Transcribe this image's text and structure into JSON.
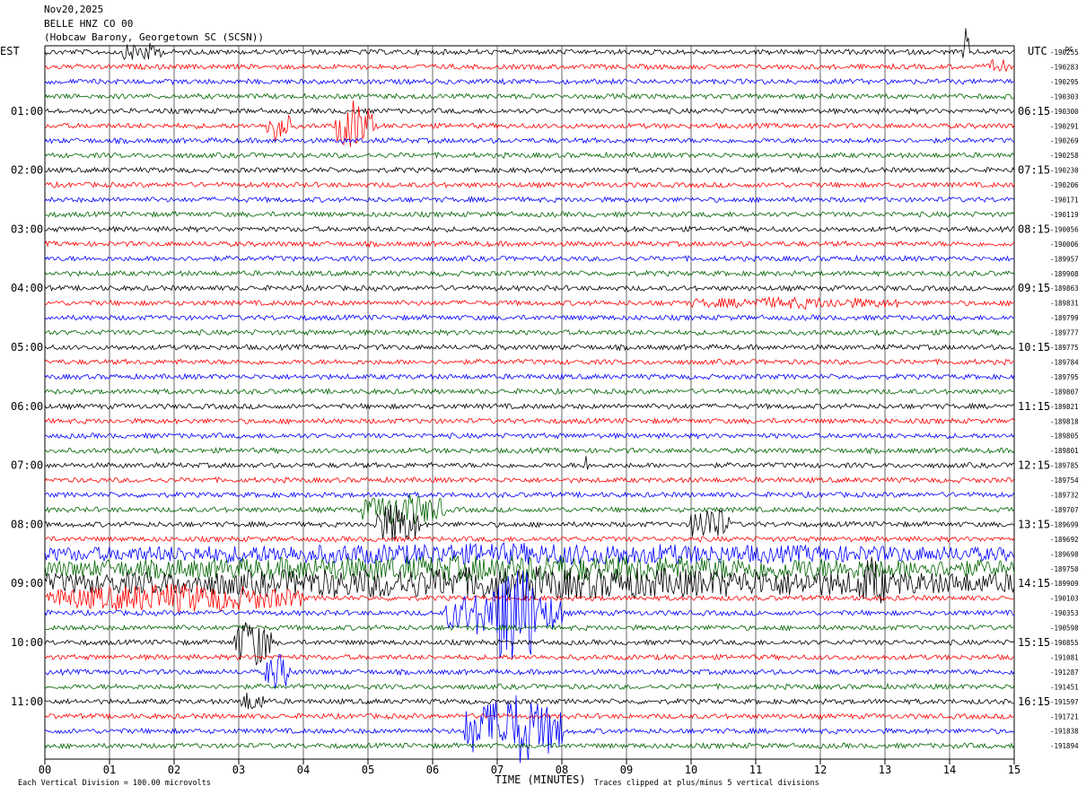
{
  "header": {
    "date": "Nov20,2025",
    "station": "BELLE HNZ CO 00",
    "location": "(Hobcaw Barony, Georgetown SC (SCSN))"
  },
  "left_zone_label": "EST",
  "right_zone_label": "UTC",
  "dc_label": "DC",
  "left_time_labels": [
    "01:00",
    "02:00",
    "03:00",
    "04:00",
    "05:00",
    "06:00",
    "07:00",
    "08:00",
    "09:00",
    "10:00",
    "11:00"
  ],
  "right_time_labels": [
    "06:15",
    "07:15",
    "08:15",
    "09:15",
    "10:15",
    "11:15",
    "12:15",
    "13:15",
    "14:15",
    "15:15",
    "16:15"
  ],
  "dc_offsets": [
    "-190255",
    "-190283",
    "-190295",
    "-190303",
    "-190300",
    "-190291",
    "-190269",
    "-190258",
    "-190230",
    "-190206",
    "-190171",
    "-190119",
    "-190056",
    "-190006",
    "-189957",
    "-189908",
    "-189863",
    "-189831",
    "-189799",
    "-189777",
    "-189775",
    "-189784",
    "-189795",
    "-189807",
    "-189821",
    "-189818",
    "-189805",
    "-189801",
    "-189785",
    "-189754",
    "-189732",
    "-189707",
    "-189699",
    "-189692",
    "-189698",
    "-189750",
    "-189909",
    "-190103",
    "-190353",
    "-190598",
    "-190855",
    "-191081",
    "-191287",
    "-191451",
    "-191597",
    "-191721",
    "-191838",
    "-191894"
  ],
  "x_tick_labels": [
    "00",
    "01",
    "02",
    "03",
    "04",
    "05",
    "06",
    "07",
    "08",
    "09",
    "10",
    "11",
    "12",
    "13",
    "14",
    "15"
  ],
  "footer": {
    "scale_note": "Each Vertical Division =  100.00 microvolts",
    "xlabel": "TIME (MINUTES)",
    "clip_note": "Traces clipped at plus/minus 5 vertical divisions"
  },
  "colors": {
    "trace_cycle": [
      "#000000",
      "#ff0000",
      "#0000ff",
      "#006400"
    ],
    "grid": "#000000"
  },
  "chart_data": {
    "type": "line",
    "description_kind": "helicorder",
    "x_range_minutes": [
      0,
      15
    ],
    "rows": 48,
    "row_minutes": 15,
    "grid": true,
    "events": [
      {
        "row": 0,
        "start_min": 1.2,
        "end_min": 1.8,
        "amp": 1.2
      },
      {
        "row": 0,
        "start_min": 14.2,
        "end_min": 14.3,
        "amp": 3.0
      },
      {
        "row": 1,
        "start_min": 14.6,
        "end_min": 14.9,
        "amp": 0.9
      },
      {
        "row": 5,
        "start_min": 3.4,
        "end_min": 3.8,
        "amp": 2.0
      },
      {
        "row": 5,
        "start_min": 4.5,
        "end_min": 5.1,
        "amp": 3.5
      },
      {
        "row": 17,
        "start_min": 10.0,
        "end_min": 13.2,
        "amp": 0.5
      },
      {
        "row": 28,
        "start_min": 8.3,
        "end_min": 8.4,
        "amp": 1.5
      },
      {
        "row": 31,
        "start_min": 4.9,
        "end_min": 6.2,
        "amp": 2.2
      },
      {
        "row": 32,
        "start_min": 5.1,
        "end_min": 5.8,
        "amp": 3.0
      },
      {
        "row": 32,
        "start_min": 10.0,
        "end_min": 10.6,
        "amp": 2.6
      },
      {
        "row": 34,
        "start_min": 0.0,
        "end_min": 15.0,
        "amp": 1.2
      },
      {
        "row": 35,
        "start_min": 0.0,
        "end_min": 15.0,
        "amp": 1.6
      },
      {
        "row": 36,
        "start_min": 0.0,
        "end_min": 15.0,
        "amp": 2.0
      },
      {
        "row": 36,
        "start_min": 12.6,
        "end_min": 13.0,
        "amp": 2.2
      },
      {
        "row": 37,
        "start_min": 0.0,
        "end_min": 4.0,
        "amp": 1.8
      },
      {
        "row": 38,
        "start_min": 6.2,
        "end_min": 8.0,
        "amp": 3.5
      },
      {
        "row": 38,
        "start_min": 7.0,
        "end_min": 7.6,
        "amp": 5.0
      },
      {
        "row": 40,
        "start_min": 2.9,
        "end_min": 3.5,
        "amp": 3.5
      },
      {
        "row": 42,
        "start_min": 3.4,
        "end_min": 3.8,
        "amp": 2.5
      },
      {
        "row": 44,
        "start_min": 3.0,
        "end_min": 3.4,
        "amp": 1.2
      },
      {
        "row": 46,
        "start_min": 6.5,
        "end_min": 8.0,
        "amp": 5.0
      }
    ]
  }
}
